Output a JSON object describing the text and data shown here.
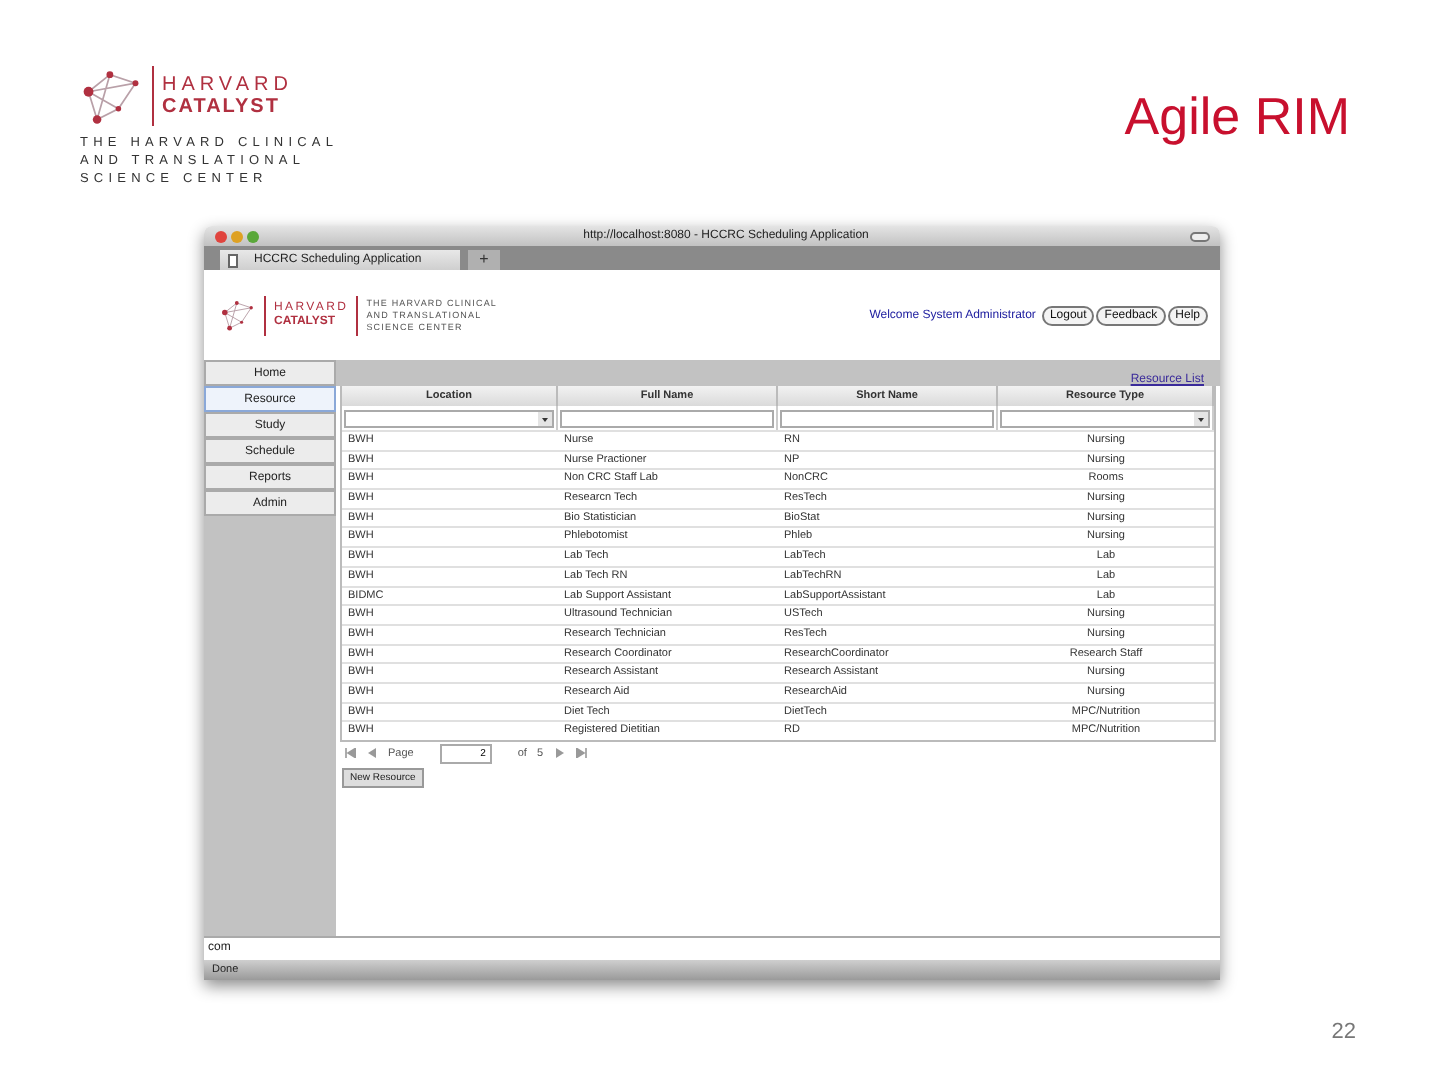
{
  "slide": {
    "title": "Agile RIM",
    "page_number": "22"
  },
  "logo": {
    "name_top": "HARVARD",
    "name_bottom": "CATALYST",
    "tagline": [
      "THE HARVARD CLINICAL",
      "AND TRANSLATIONAL",
      "SCIENCE CENTER"
    ]
  },
  "browser": {
    "title": "http://localhost:8080 - HCCRC Scheduling Application",
    "tab": "HCCRC Scheduling Application",
    "new_tab": "+",
    "address_hint": "com",
    "status": "Done"
  },
  "app_header": {
    "logo_top": "HARVARD",
    "logo_bottom": "CATALYST",
    "tagline": [
      "THE HARVARD CLINICAL",
      "AND TRANSLATIONAL",
      "SCIENCE CENTER"
    ],
    "welcome": "Welcome System Administrator",
    "buttons": [
      "Logout",
      "Feedback",
      "Help"
    ]
  },
  "sidebar": {
    "items": [
      {
        "label": "Home",
        "selected": false
      },
      {
        "label": "Resource",
        "selected": true
      },
      {
        "label": "Study",
        "selected": false
      },
      {
        "label": "Schedule",
        "selected": false
      },
      {
        "label": "Reports",
        "selected": false
      },
      {
        "label": "Admin",
        "selected": false
      }
    ]
  },
  "resource_list_link": "Resource List",
  "table": {
    "columns": [
      "Location",
      "Full Name",
      "Short Name",
      "Resource Type"
    ],
    "filters": [
      {
        "kind": "dropdown"
      },
      {
        "kind": "text"
      },
      {
        "kind": "text"
      },
      {
        "kind": "dropdown"
      }
    ],
    "rows": [
      [
        "BWH",
        "Nurse",
        "RN",
        "Nursing"
      ],
      [
        "BWH",
        "Nurse Practioner",
        "NP",
        "Nursing"
      ],
      [
        "BWH",
        "Non CRC Staff Lab",
        "NonCRC",
        "Rooms"
      ],
      [
        "BWH",
        "Researcn Tech",
        "ResTech",
        "Nursing"
      ],
      [
        "BWH",
        "Bio Statistician",
        "BioStat",
        "Nursing"
      ],
      [
        "BWH",
        "Phlebotomist",
        "Phleb",
        "Nursing"
      ],
      [
        "BWH",
        "Lab Tech",
        "LabTech",
        "Lab"
      ],
      [
        "BWH",
        "Lab Tech RN",
        "LabTechRN",
        "Lab"
      ],
      [
        "BIDMC",
        "Lab Support Assistant",
        "LabSupportAssistant",
        "Lab"
      ],
      [
        "BWH",
        "Ultrasound Technician",
        "USTech",
        "Nursing"
      ],
      [
        "BWH",
        "Research Technician",
        "ResTech",
        "Nursing"
      ],
      [
        "BWH",
        "Research Coordinator",
        "ResearchCoordinator",
        "Research Staff"
      ],
      [
        "BWH",
        "Research Assistant",
        "Research Assistant",
        "Nursing"
      ],
      [
        "BWH",
        "Research Aid",
        "ResearchAid",
        "Nursing"
      ],
      [
        "BWH",
        "Diet Tech",
        "DietTech",
        "MPC/Nutrition"
      ],
      [
        "BWH",
        "Registered Dietitian",
        "RD",
        "MPC/Nutrition"
      ]
    ]
  },
  "pager": {
    "page_label": "Page",
    "page": "2",
    "of_label": "of",
    "total": "5"
  },
  "new_button": "New Resource"
}
